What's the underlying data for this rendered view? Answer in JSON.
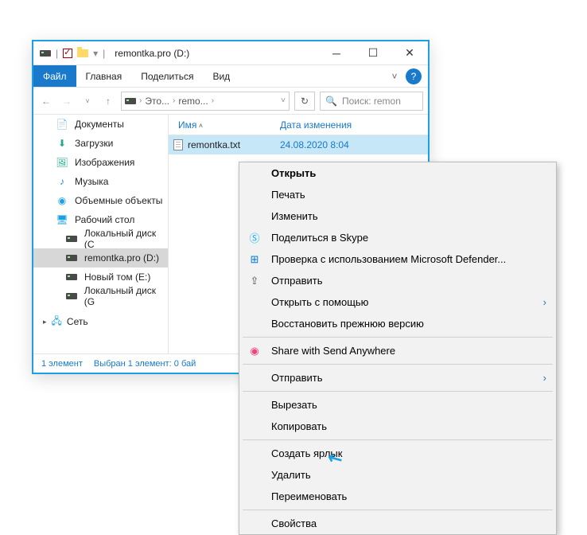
{
  "title": "remontka.pro (D:)",
  "tabs": {
    "file": "Файл",
    "home": "Главная",
    "share": "Поделиться",
    "view": "Вид"
  },
  "breadcrumb": {
    "pc": "Это...",
    "drive": "remo..."
  },
  "search": {
    "placeholder": "Поиск: remon"
  },
  "nav": {
    "documents": "Документы",
    "downloads": "Загрузки",
    "pictures": "Изображения",
    "music": "Музыка",
    "objects3d": "Объемные объекты",
    "desktop": "Рабочий стол",
    "diskC": "Локальный диск (C",
    "drive": "remontka.pro (D:)",
    "diskE": "Новый том (E:)",
    "diskG": "Локальный диск (G",
    "network": "Сеть"
  },
  "columns": {
    "name": "Имя",
    "date": "Дата изменения"
  },
  "file": {
    "name": "remontka.txt",
    "date": "24.08.2020 8:04"
  },
  "status": {
    "count": "1 элемент",
    "selected": "Выбран 1 элемент: 0 бай"
  },
  "ctx": {
    "open": "Открыть",
    "print": "Печать",
    "edit": "Изменить",
    "skype": "Поделиться в Skype",
    "defender": "Проверка с использованием Microsoft Defender...",
    "share": "Отправить",
    "openwith": "Открыть с помощью",
    "restore": "Восстановить прежнюю версию",
    "sendanywhere": "Share with Send Anywhere",
    "sendto": "Отправить",
    "cut": "Вырезать",
    "copy": "Копировать",
    "shortcut": "Создать ярлык",
    "delete": "Удалить",
    "rename": "Переименовать",
    "properties": "Свойства"
  }
}
